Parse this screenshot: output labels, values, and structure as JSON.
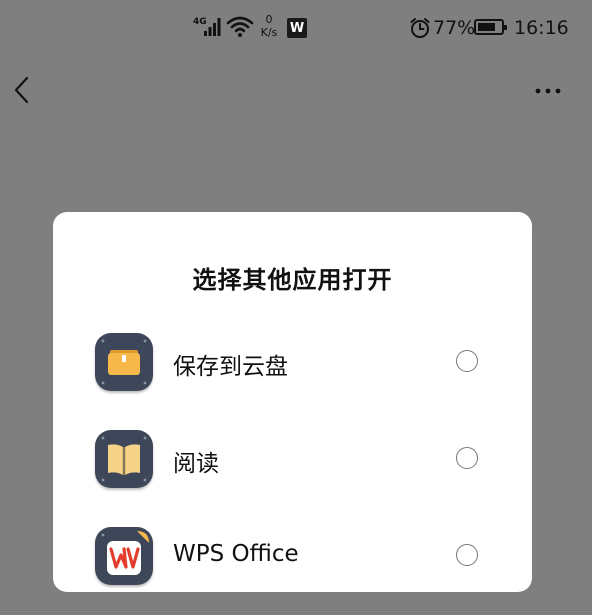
{
  "status_bar": {
    "network_type": "4G",
    "net_speed_value": "0",
    "net_speed_unit": "K/s",
    "wps_badge": "W",
    "battery_percent_text": "77%",
    "battery_level": 0.77,
    "time": "16:16",
    "icons": [
      "signal-icon",
      "wifi-icon",
      "wps-notification-icon",
      "alarm-icon",
      "battery-icon"
    ]
  },
  "nav": {
    "back_icon": "chevron-left-icon",
    "more_icon": "more-dots-icon"
  },
  "dialog": {
    "title": "选择其他应用打开",
    "options": [
      {
        "label": "保存到云盘",
        "icon": "cloud-save-icon",
        "selected": false
      },
      {
        "label": "阅读",
        "icon": "book-reader-icon",
        "selected": false
      },
      {
        "label": "WPS Office",
        "icon": "wps-office-icon",
        "selected": false
      }
    ]
  },
  "colors": {
    "overlay": "#7f7f7f",
    "dialog_bg": "#ffffff",
    "app_icon_bg": "#3e4759",
    "folder_yellow": "#f7b84b",
    "wps_red": "#e23c2c"
  }
}
